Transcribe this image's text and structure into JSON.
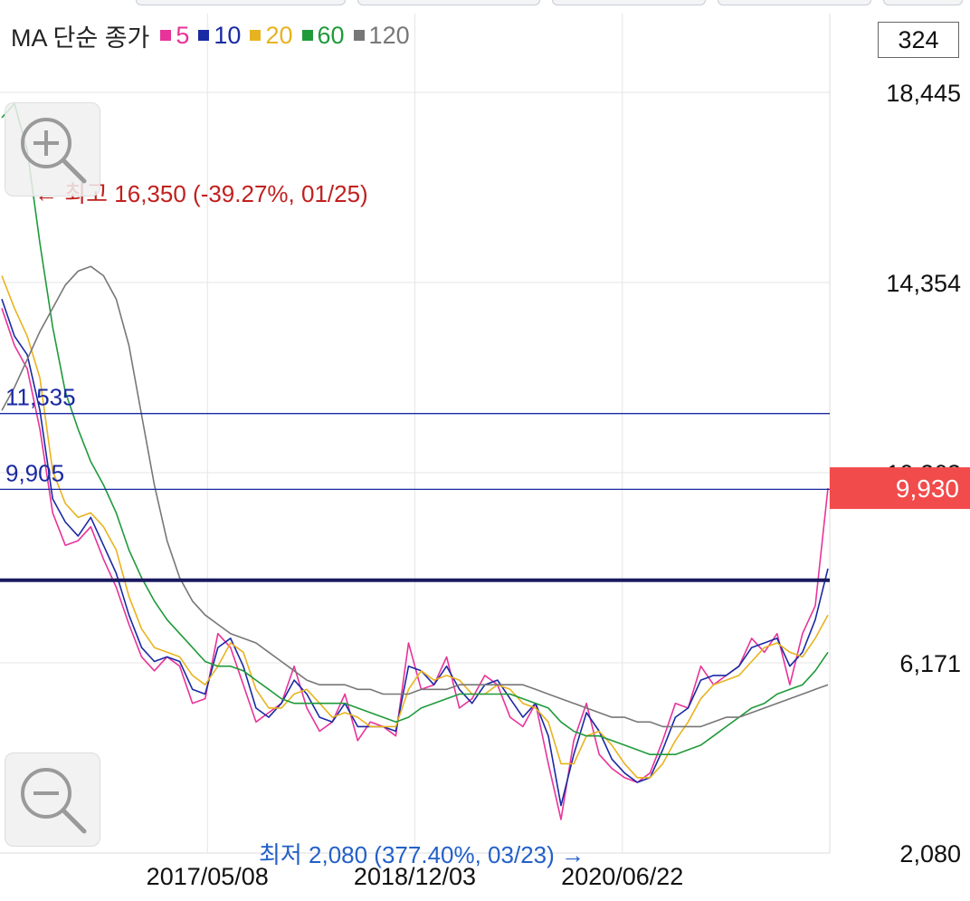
{
  "legend": {
    "title": "MA 단순 종가",
    "items": [
      {
        "label": "5",
        "color": "#e8339a"
      },
      {
        "label": "10",
        "color": "#1a2aa3"
      },
      {
        "label": "20",
        "color": "#e8b320"
      },
      {
        "label": "60",
        "color": "#1f9a3b"
      },
      {
        "label": "120",
        "color": "#777777"
      }
    ]
  },
  "candle_count": "324",
  "zoom_in": {
    "icon": "zoom-in-icon"
  },
  "zoom_out": {
    "icon": "zoom-out-icon"
  },
  "chart_data": {
    "type": "line",
    "y_axis_labels": [
      "18,445",
      "14,354",
      "10,263",
      "6,171",
      "2,080"
    ],
    "ylim": [
      2080,
      18445
    ],
    "x_labels": [
      "2017/05/08",
      "2018/12/03",
      "2020/06/22"
    ],
    "current_price": {
      "value": 9930,
      "label": "9,930",
      "color": "#f24b4b"
    },
    "high_annotation": {
      "text": "← 최고 16,350 (-39.27%, 01/25)",
      "value": 16350,
      "color": "#c0201e"
    },
    "low_annotation": {
      "text": "최저 2,080 (377.40%, 03/23) →",
      "value": 2080,
      "color": "#2360c8"
    },
    "hlines": [
      {
        "label": "11,535",
        "value": 11535,
        "color": "#1a2aa3"
      },
      {
        "label": "9,905",
        "value": 9905,
        "color": "#1a2aa3"
      },
      {
        "label": "",
        "value": 7950,
        "color": "#1a1a60"
      }
    ],
    "series": [
      {
        "name": "5",
        "color": "#e8339a",
        "values": [
          13800,
          13000,
          12500,
          11200,
          9400,
          8700,
          8800,
          9100,
          8400,
          7800,
          7000,
          6300,
          6000,
          6300,
          6100,
          5300,
          5400,
          6800,
          6500,
          5700,
          4900,
          5100,
          5300,
          6100,
          5200,
          4700,
          4900,
          5500,
          4500,
          4900,
          4800,
          4600,
          6600,
          5600,
          5700,
          6300,
          5200,
          5400,
          5900,
          5700,
          5000,
          4800,
          5300,
          4000,
          2800,
          4500,
          5300,
          4200,
          3900,
          3700,
          3600,
          3800,
          4500,
          5300,
          5200,
          6100,
          5700,
          5900,
          6100,
          6700,
          6400,
          6800,
          5700,
          6800,
          7400,
          9930
        ]
      },
      {
        "name": "10",
        "color": "#1a2aa3",
        "values": [
          14000,
          13200,
          12800,
          11600,
          9700,
          9200,
          8900,
          9300,
          8700,
          8100,
          7200,
          6500,
          6200,
          6300,
          6200,
          5600,
          5500,
          6500,
          6700,
          6100,
          5200,
          5000,
          5300,
          5800,
          5500,
          5000,
          4900,
          5300,
          4800,
          4800,
          4800,
          4700,
          6100,
          6000,
          5700,
          6100,
          5600,
          5300,
          5700,
          5800,
          5400,
          5000,
          5300,
          4600,
          3100,
          4200,
          5100,
          4700,
          4100,
          3800,
          3600,
          3700,
          4300,
          5000,
          5200,
          5800,
          5900,
          5900,
          6100,
          6500,
          6600,
          6700,
          6100,
          6400,
          7100,
          8200
        ]
      },
      {
        "name": "20",
        "color": "#e8b320",
        "values": [
          14500,
          13800,
          13200,
          12300,
          10300,
          9600,
          9300,
          9400,
          9100,
          8600,
          7600,
          6900,
          6500,
          6400,
          6300,
          5900,
          5700,
          6100,
          6600,
          6400,
          5600,
          5200,
          5200,
          5500,
          5600,
          5300,
          5000,
          5100,
          5000,
          4800,
          4800,
          4800,
          5600,
          6000,
          5800,
          5900,
          5800,
          5500,
          5500,
          5700,
          5600,
          5300,
          5200,
          4900,
          4000,
          4000,
          4600,
          4700,
          4400,
          4000,
          3700,
          3700,
          4000,
          4500,
          4900,
          5400,
          5700,
          5800,
          5900,
          6200,
          6500,
          6600,
          6400,
          6300,
          6700,
          7200
        ]
      },
      {
        "name": "60",
        "color": "#1f9a3b",
        "values": [
          17900,
          18200,
          17200,
          15200,
          13400,
          12000,
          11200,
          10500,
          10000,
          9400,
          8600,
          8000,
          7500,
          7100,
          6800,
          6500,
          6200,
          6100,
          6100,
          6000,
          5800,
          5600,
          5400,
          5300,
          5300,
          5300,
          5300,
          5300,
          5200,
          5100,
          5000,
          4900,
          5000,
          5200,
          5300,
          5400,
          5500,
          5500,
          5500,
          5500,
          5500,
          5400,
          5300,
          5200,
          4900,
          4700,
          4600,
          4600,
          4500,
          4400,
          4300,
          4200,
          4200,
          4200,
          4300,
          4400,
          4600,
          4800,
          5000,
          5200,
          5300,
          5500,
          5600,
          5700,
          6000,
          6400
        ]
      },
      {
        "name": "120",
        "color": "#777777",
        "values": [
          11600,
          12100,
          12700,
          13300,
          13800,
          14300,
          14600,
          14700,
          14500,
          14000,
          13000,
          11500,
          10000,
          8800,
          8000,
          7500,
          7200,
          7000,
          6800,
          6700,
          6600,
          6400,
          6200,
          6000,
          5800,
          5700,
          5700,
          5700,
          5600,
          5600,
          5500,
          5500,
          5500,
          5600,
          5600,
          5600,
          5700,
          5700,
          5700,
          5700,
          5700,
          5700,
          5600,
          5500,
          5400,
          5300,
          5200,
          5100,
          5000,
          5000,
          4900,
          4900,
          4800,
          4800,
          4800,
          4800,
          4900,
          5000,
          5000,
          5100,
          5200,
          5300,
          5400,
          5500,
          5600,
          5700
        ]
      }
    ],
    "grid": true
  }
}
